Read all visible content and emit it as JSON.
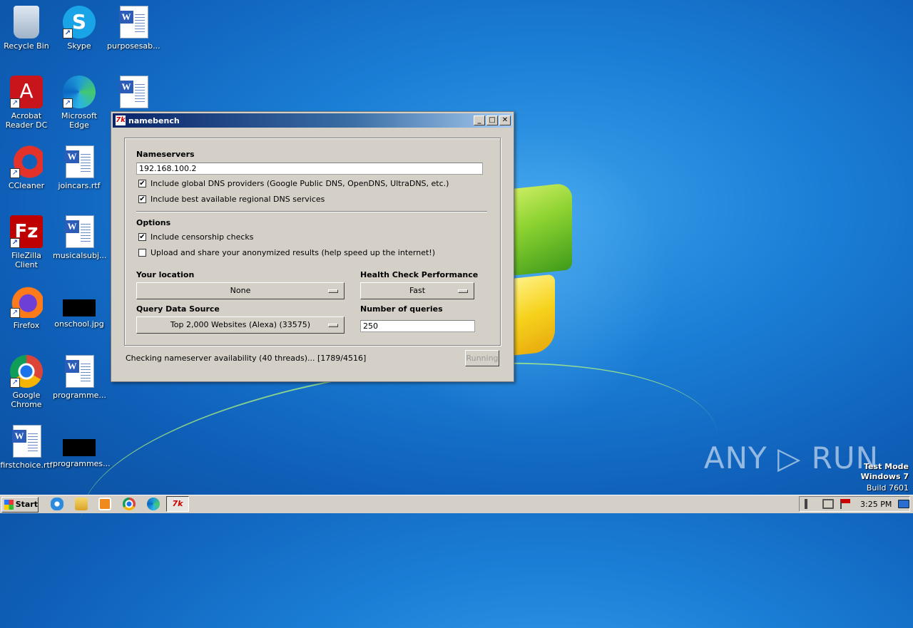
{
  "desktop": {
    "icons": [
      {
        "label": "Recycle Bin"
      },
      {
        "label": "Skype"
      },
      {
        "label": "purposesab..."
      },
      {
        "label": "Acrobat Reader DC"
      },
      {
        "label": "Microsoft Edge"
      },
      {
        "label": "CCleaner"
      },
      {
        "label": "joincars.rtf"
      },
      {
        "label": "FileZilla Client"
      },
      {
        "label": "musicalsubj..."
      },
      {
        "label": "Firefox"
      },
      {
        "label": "onschool.jpg"
      },
      {
        "label": "Google Chrome"
      },
      {
        "label": "programme..."
      },
      {
        "label": "firstchoice.rtf"
      },
      {
        "label": "programmes..."
      }
    ],
    "watermark": "ANY ▷ RUN",
    "os_info": {
      "line1": "Test Mode",
      "line2": "Windows 7",
      "line3": "Build 7601"
    }
  },
  "window": {
    "title": "namebench",
    "app_icon_text": "7k",
    "nameservers_heading": "Nameservers",
    "nameservers_value": "192.168.100.2",
    "include_global_label": "Include global DNS providers (Google Public DNS, OpenDNS, UltraDNS, etc.)",
    "include_global_checked": true,
    "include_regional_label": "Include best available regional DNS services",
    "include_regional_checked": true,
    "options_heading": "Options",
    "censorship_label": "Include censorship checks",
    "censorship_checked": true,
    "upload_label": "Upload and share your anonymized results (help speed up the internet!)",
    "upload_checked": false,
    "location_heading": "Your location",
    "location_value": "None",
    "health_heading": "Health Check Performance",
    "health_value": "Fast",
    "query_source_heading": "Query Data Source",
    "query_source_value": "Top 2,000 Websites (Alexa) (33575)",
    "num_queries_heading": "Number of queries",
    "num_queries_value": "250",
    "status_text": "Checking nameserver availability (40 threads)... [1789/4516]",
    "run_button_label": "Running",
    "check_mark": "✔",
    "minimize_glyph": "_",
    "maximize_glyph": "□",
    "close_glyph": "✕"
  },
  "taskbar": {
    "start_label": "Start",
    "active_task_label": "7k",
    "clock": "3:25 PM"
  }
}
